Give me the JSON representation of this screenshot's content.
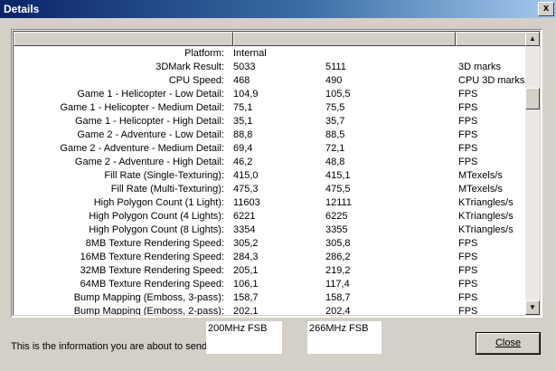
{
  "window": {
    "title": "Details",
    "close_glyph": "x"
  },
  "rows": [
    [
      "Platform:",
      "Internal",
      "",
      ""
    ],
    [
      "3DMark Result:",
      "5033",
      "5111",
      "3D marks"
    ],
    [
      "CPU Speed:",
      "468",
      "490",
      "CPU 3D marks"
    ],
    [
      "Game 1 - Helicopter - Low Detail:",
      "104,9",
      "105,5",
      "FPS"
    ],
    [
      "Game 1 - Helicopter - Medium Detail:",
      "75,1",
      "75,5",
      "FPS"
    ],
    [
      "Game 1 - Helicopter - High Detail:",
      "35,1",
      "35,7",
      "FPS"
    ],
    [
      "Game 2 - Adventure - Low Detail:",
      "88,8",
      "88,5",
      "FPS"
    ],
    [
      "Game 2 - Adventure - Medium Detail:",
      "69,4",
      "72,1",
      "FPS"
    ],
    [
      "Game 2 - Adventure - High Detail:",
      "46,2",
      "48,8",
      "FPS"
    ],
    [
      "Fill Rate (Single-Texturing):",
      "415,0",
      "415,1",
      "MTexels/s"
    ],
    [
      "Fill Rate (Multi-Texturing):",
      "475,3",
      "475,5",
      "MTexels/s"
    ],
    [
      "High Polygon Count (1 Light):",
      "11603",
      "12111",
      "KTriangles/s"
    ],
    [
      "High Polygon Count (4 Lights):",
      "6221",
      "6225",
      "KTriangles/s"
    ],
    [
      "High Polygon Count (8 Lights):",
      "3354",
      "3355",
      "KTriangles/s"
    ],
    [
      "8MB Texture Rendering Speed:",
      "305,2",
      "305,8",
      "FPS"
    ],
    [
      "16MB Texture Rendering Speed:",
      "284,3",
      "286,2",
      "FPS"
    ],
    [
      "32MB Texture Rendering Speed:",
      "205,1",
      "219,2",
      "FPS"
    ],
    [
      "64MB Texture Rendering Speed:",
      "106,1",
      "117,4",
      "FPS"
    ],
    [
      "Bump Mapping (Emboss, 3-pass):",
      "158,7",
      "158,7",
      "FPS"
    ],
    [
      "Bump Mapping (Emboss, 2-pass):",
      "202,1",
      "202,4",
      "FPS"
    ]
  ],
  "footer": {
    "info_text": "This is the information you are about to send",
    "overlay_left": "200MHz FSB",
    "overlay_right": "266MHz FSB",
    "close_label": "Close"
  },
  "scroll": {
    "up_glyph": "▲",
    "down_glyph": "▼"
  }
}
